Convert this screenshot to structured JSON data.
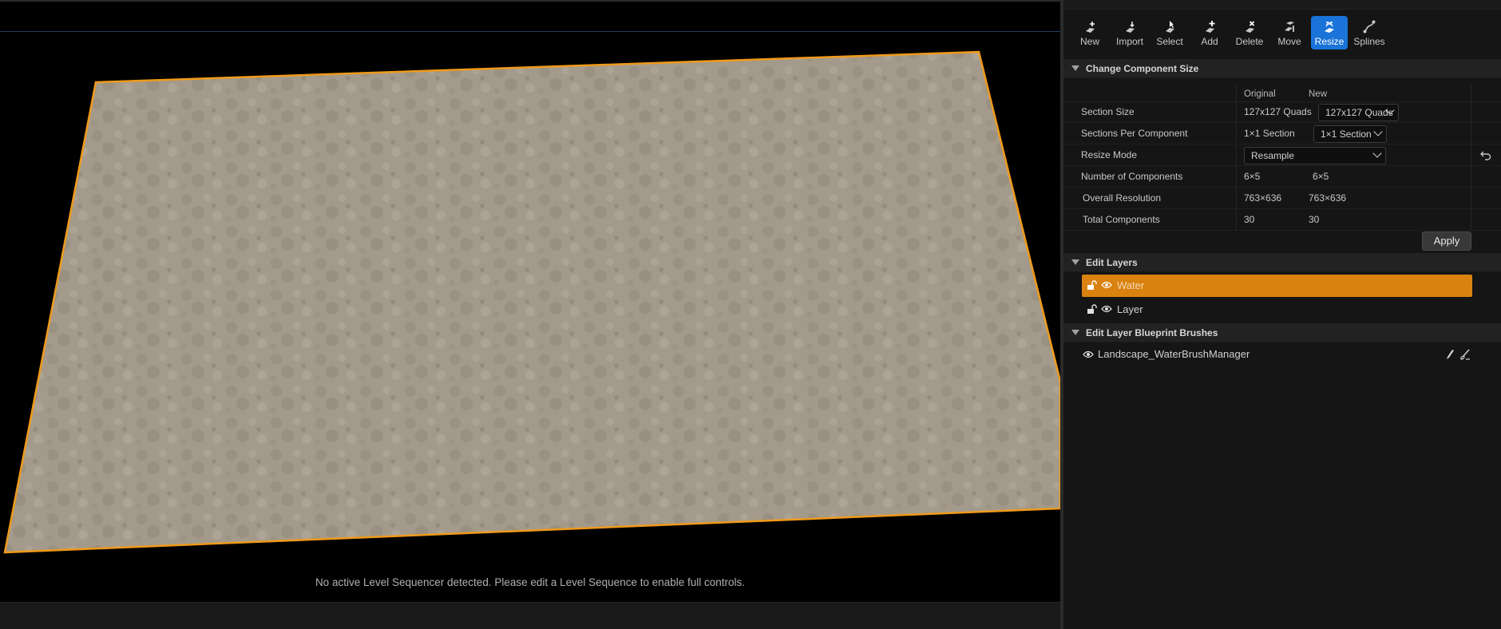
{
  "viewport": {
    "sequencer_message": "No active Level Sequencer detected. Please edit a Level Sequence to enable full controls."
  },
  "toolbar": {
    "tools": [
      {
        "label": "New",
        "icon": "new-icon"
      },
      {
        "label": "Import",
        "icon": "import-icon"
      },
      {
        "label": "Select",
        "icon": "select-icon"
      },
      {
        "label": "Add",
        "icon": "add-icon"
      },
      {
        "label": "Delete",
        "icon": "delete-icon"
      },
      {
        "label": "Move",
        "icon": "move-icon"
      },
      {
        "label": "Resize",
        "icon": "resize-icon",
        "active": true
      },
      {
        "label": "Splines",
        "icon": "splines-icon"
      }
    ]
  },
  "change_size": {
    "title": "Change Component Size",
    "col_original": "Original",
    "col_new": "New",
    "section_size": {
      "label": "Section Size",
      "original": "127x127 Quads",
      "new": "127x127 Quads"
    },
    "sections_per_component": {
      "label": "Sections Per Component",
      "original": "1×1 Section",
      "new": "1×1 Section"
    },
    "resize_mode": {
      "label": "Resize Mode",
      "value": "Resample"
    },
    "num_components": {
      "label": "Number of Components",
      "original": "6×5",
      "new": "6×5"
    },
    "overall_resolution": {
      "label": "Overall Resolution",
      "original": "763×636",
      "new": "763×636"
    },
    "total_components": {
      "label": "Total Components",
      "original": "30",
      "new": "30"
    },
    "apply_label": "Apply"
  },
  "edit_layers": {
    "title": "Edit Layers",
    "layers": [
      {
        "name": "Water",
        "selected": true
      },
      {
        "name": "Layer",
        "selected": false
      }
    ]
  },
  "blueprint_brushes": {
    "title": "Edit Layer Blueprint Brushes",
    "items": [
      {
        "name": "Landscape_WaterBrushManager"
      }
    ]
  },
  "colors": {
    "accent_blue": "#1a73d8",
    "selected_layer": "#d9820f",
    "landscape_outline": "#f09a1a"
  }
}
